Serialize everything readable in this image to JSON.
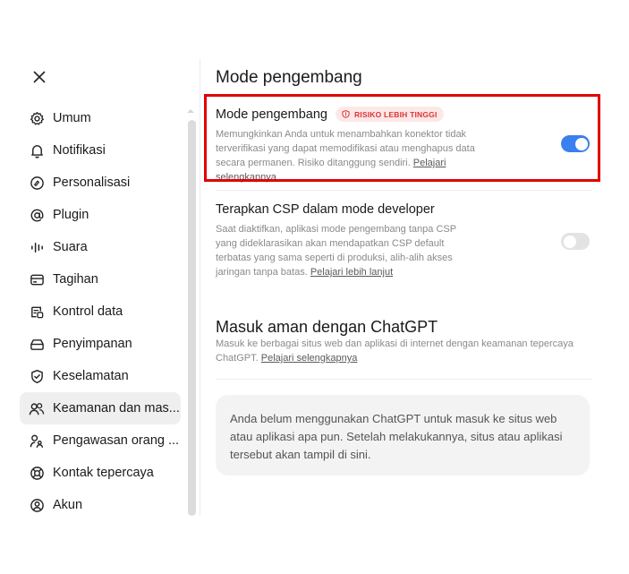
{
  "close_label": "×",
  "sidebar": {
    "items": [
      {
        "label": "Umum",
        "icon": "gear-icon"
      },
      {
        "label": "Notifikasi",
        "icon": "bell-icon"
      },
      {
        "label": "Personalisasi",
        "icon": "personalize-icon"
      },
      {
        "label": "Plugin",
        "icon": "at-icon"
      },
      {
        "label": "Suara",
        "icon": "waveform-icon"
      },
      {
        "label": "Tagihan",
        "icon": "card-icon"
      },
      {
        "label": "Kontrol data",
        "icon": "data-control-icon"
      },
      {
        "label": "Penyimpanan",
        "icon": "storage-icon"
      },
      {
        "label": "Keselamatan",
        "icon": "shield-check-icon"
      },
      {
        "label": "Keamanan dan mas...",
        "icon": "people-icon",
        "active": true
      },
      {
        "label": "Pengawasan orang ...",
        "icon": "parent-icon"
      },
      {
        "label": "Kontak tepercaya",
        "icon": "lifebuoy-icon"
      },
      {
        "label": "Akun",
        "icon": "account-icon"
      }
    ]
  },
  "main": {
    "section_title": "Mode pengembang",
    "dev_mode": {
      "title": "Mode pengembang",
      "badge": "RISIKO LEBIH TINGGI",
      "description": "Memungkinkan Anda untuk menambahkan konektor tidak terverifikasi yang dapat memodifikasi atau menghapus data secara permanen. Risiko ditanggung sendiri.",
      "link": "Pelajari selengkapnya",
      "enabled": true
    },
    "csp": {
      "title": "Terapkan CSP dalam mode developer",
      "description": "Saat diaktifkan, aplikasi mode pengembang tanpa CSP yang dideklarasikan akan mendapatkan CSP default terbatas yang sama seperti di produksi, alih-alih akses jaringan tanpa batas.",
      "link": "Pelajari lebih lanjut",
      "enabled": false
    },
    "signin": {
      "title": "Masuk aman dengan ChatGPT",
      "description": "Masuk ke berbagai situs web dan aplikasi di internet dengan keamanan tepercaya ChatGPT.",
      "link": "Pelajari selengkapnya",
      "empty_message": "Anda belum menggunakan ChatGPT untuk masuk ke situs web atau aplikasi apa pun. Setelah melakukannya, situs atau aplikasi tersebut akan tampil di sini."
    }
  },
  "colors": {
    "accent": "#3b7ff0",
    "risk": "#d33333",
    "highlight": "#e00000"
  }
}
